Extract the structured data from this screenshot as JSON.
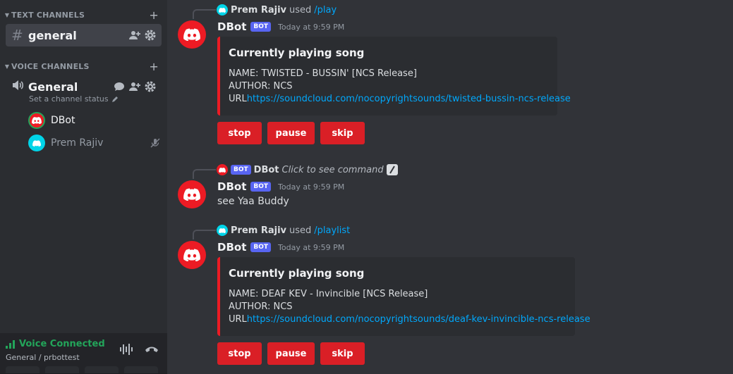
{
  "sidebar": {
    "text_category": "TEXT CHANNELS",
    "voice_category": "VOICE CHANNELS",
    "text_channel": {
      "name": "general"
    },
    "voice_channel": {
      "name": "General",
      "status": "Set a channel status"
    },
    "voice_users": [
      {
        "name": "DBot",
        "avatar_color": "#ed1b24"
      },
      {
        "name": "Prem Rajiv",
        "avatar_color": "#00d4e8"
      }
    ],
    "voice_panel": {
      "title": "Voice Connected",
      "subtitle": "General / prbottest"
    }
  },
  "messages": [
    {
      "reply": {
        "user": "Prem Rajiv",
        "verb": "used",
        "command": "/play"
      },
      "author": "DBot",
      "badge": "BOT",
      "timestamp": "Today at 9:59 PM",
      "embed": {
        "title": "Currently playing song",
        "name_line": "NAME: TWISTED - BUSSIN' [NCS Release]",
        "author_line": "AUTHOR: NCS",
        "url_prefix": "URL",
        "url": "https://soundcloud.com/nocopyrightsounds/twisted-bussin-ncs-release"
      },
      "buttons": [
        "stop",
        "pause",
        "skip"
      ]
    },
    {
      "reply": {
        "badge": "BOT",
        "user": "DBot",
        "hint": "Click to see command"
      },
      "author": "DBot",
      "badge": "BOT",
      "timestamp": "Today at 9:59 PM",
      "text": "see Yaa Buddy"
    },
    {
      "reply": {
        "user": "Prem Rajiv",
        "verb": "used",
        "command": "/playlist"
      },
      "author": "DBot",
      "badge": "BOT",
      "timestamp": "Today at 9:59 PM",
      "embed": {
        "title": "Currently playing song",
        "name_line": "NAME: DEAF KEV - Invincible [NCS Release]",
        "author_line": "AUTHOR: NCS",
        "url_prefix": "URL",
        "url": "https://soundcloud.com/nocopyrightsounds/deaf-kev-invincible-ncs-release"
      },
      "buttons": [
        "stop",
        "pause",
        "skip"
      ]
    }
  ],
  "colors": {
    "accent_red": "#ed1b24",
    "button_red": "#da1f26",
    "link": "#00a8fc",
    "voice_green": "#23a55a",
    "bot_badge": "#5865f2"
  }
}
